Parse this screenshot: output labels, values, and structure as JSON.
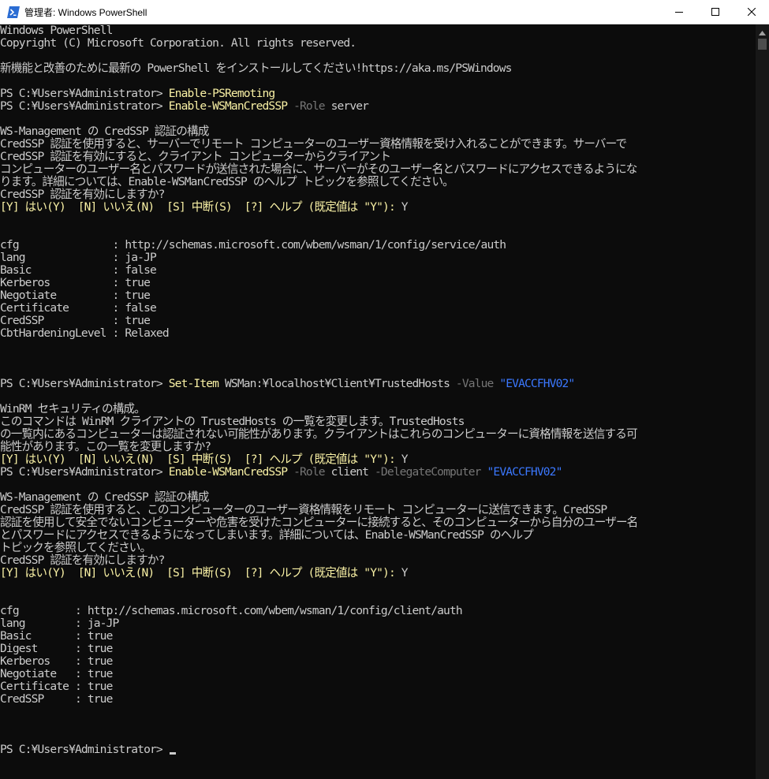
{
  "window": {
    "title": "管理者: Windows PowerShell",
    "app_icon": "powershell-icon",
    "controls": [
      "minimize-icon",
      "maximize-icon",
      "close-icon"
    ]
  },
  "colors": {
    "background": "#0c0c0c",
    "text": "#cccccc",
    "command": "#f9f1a5",
    "parameter": "#767676",
    "string": "#3b78ff"
  },
  "console": {
    "l0": "Windows PowerShell",
    "l1": "Copyright (C) Microsoft Corporation. All rights reserved.",
    "l3": "新機能と改善のために最新の PowerShell をインストールしてください!https://aka.ms/PSWindows",
    "l5": {
      "prompt": "PS C:¥Users¥Administrator> ",
      "cmd": "Enable-PSRemoting"
    },
    "l6": {
      "prompt": "PS C:¥Users¥Administrator> ",
      "cmd": "Enable-WSManCredSSP",
      "p1": " -Role",
      "a1": " server"
    },
    "l8": "WS-Management の CredSSP 認証の構成",
    "l9": "CredSSP 認証を使用すると、サーバーでリモート コンピューターのユーザー資格情報を受け入れることができます。サーバーで",
    "l10": "CredSSP 認証を有効にすると、クライアント コンピューターからクライアント",
    "l11": "コンピューターのユーザー名とパスワードが送信された場合に、サーバーがそのユーザー名とパスワードにアクセスできるようにな",
    "l12": "ります。詳細については、Enable-WSManCredSSP のヘルプ トピックを参照してください。",
    "l13": "CredSSP 認証を有効にしますか?",
    "l14": {
      "choices": "[Y] はい(Y)  [N] いいえ(N)  [S] 中断(S)  [?] ヘルプ (既定値は \"Y\"): ",
      "answer": "Y"
    },
    "l17": "cfg               : http://schemas.microsoft.com/wbem/wsman/1/config/service/auth",
    "l18": "lang              : ja-JP",
    "l19": "Basic             : false",
    "l20": "Kerberos          : true",
    "l21": "Negotiate         : true",
    "l22": "Certificate       : false",
    "l23": "CredSSP           : true",
    "l24": "CbtHardeningLevel : Relaxed",
    "l28": {
      "prompt": "PS C:¥Users¥Administrator> ",
      "cmd": "Set-Item",
      "a1": " WSMan:¥localhost¥Client¥TrustedHosts",
      "p1": " -Value",
      "s1": " \"EVACCFHV02\""
    },
    "l30": "WinRM セキュリティの構成。",
    "l31": "このコマンドは WinRM クライアントの TrustedHosts の一覧を変更します。TrustedHosts",
    "l32": "の一覧内にあるコンピューターは認証されない可能性があります。クライアントはこれらのコンピューターに資格情報を送信する可",
    "l33": "能性があります。この一覧を変更しますか?",
    "l34": {
      "choices": "[Y] はい(Y)  [N] いいえ(N)  [S] 中断(S)  [?] ヘルプ (既定値は \"Y\"): ",
      "answer": "Y"
    },
    "l35": {
      "prompt": "PS C:¥Users¥Administrator> ",
      "cmd": "Enable-WSManCredSSP",
      "p1": " -Role",
      "a1": " client",
      "p2": " -DelegateComputer",
      "s1": " \"EVACCFHV02\""
    },
    "l37": "WS-Management の CredSSP 認証の構成",
    "l38": "CredSSP 認証を使用すると、このコンピューターのユーザー資格情報をリモート コンピューターに送信できます。CredSSP",
    "l39": "認証を使用して安全でないコンピューターや危害を受けたコンピューターに接続すると、そのコンピューターから自分のユーザー名",
    "l40": "とパスワードにアクセスできるようになってしまいます。詳細については、Enable-WSManCredSSP のヘルプ",
    "l41": "トピックを参照してください。",
    "l42": "CredSSP 認証を有効にしますか?",
    "l43": {
      "choices": "[Y] はい(Y)  [N] いいえ(N)  [S] 中断(S)  [?] ヘルプ (既定値は \"Y\"): ",
      "answer": "Y"
    },
    "l46": "cfg         : http://schemas.microsoft.com/wbem/wsman/1/config/client/auth",
    "l47": "lang        : ja-JP",
    "l48": "Basic       : true",
    "l49": "Digest      : true",
    "l50": "Kerberos    : true",
    "l51": "Negotiate   : true",
    "l52": "Certificate : true",
    "l53": "CredSSP     : true",
    "l57": {
      "prompt": "PS C:¥Users¥Administrator> "
    }
  }
}
